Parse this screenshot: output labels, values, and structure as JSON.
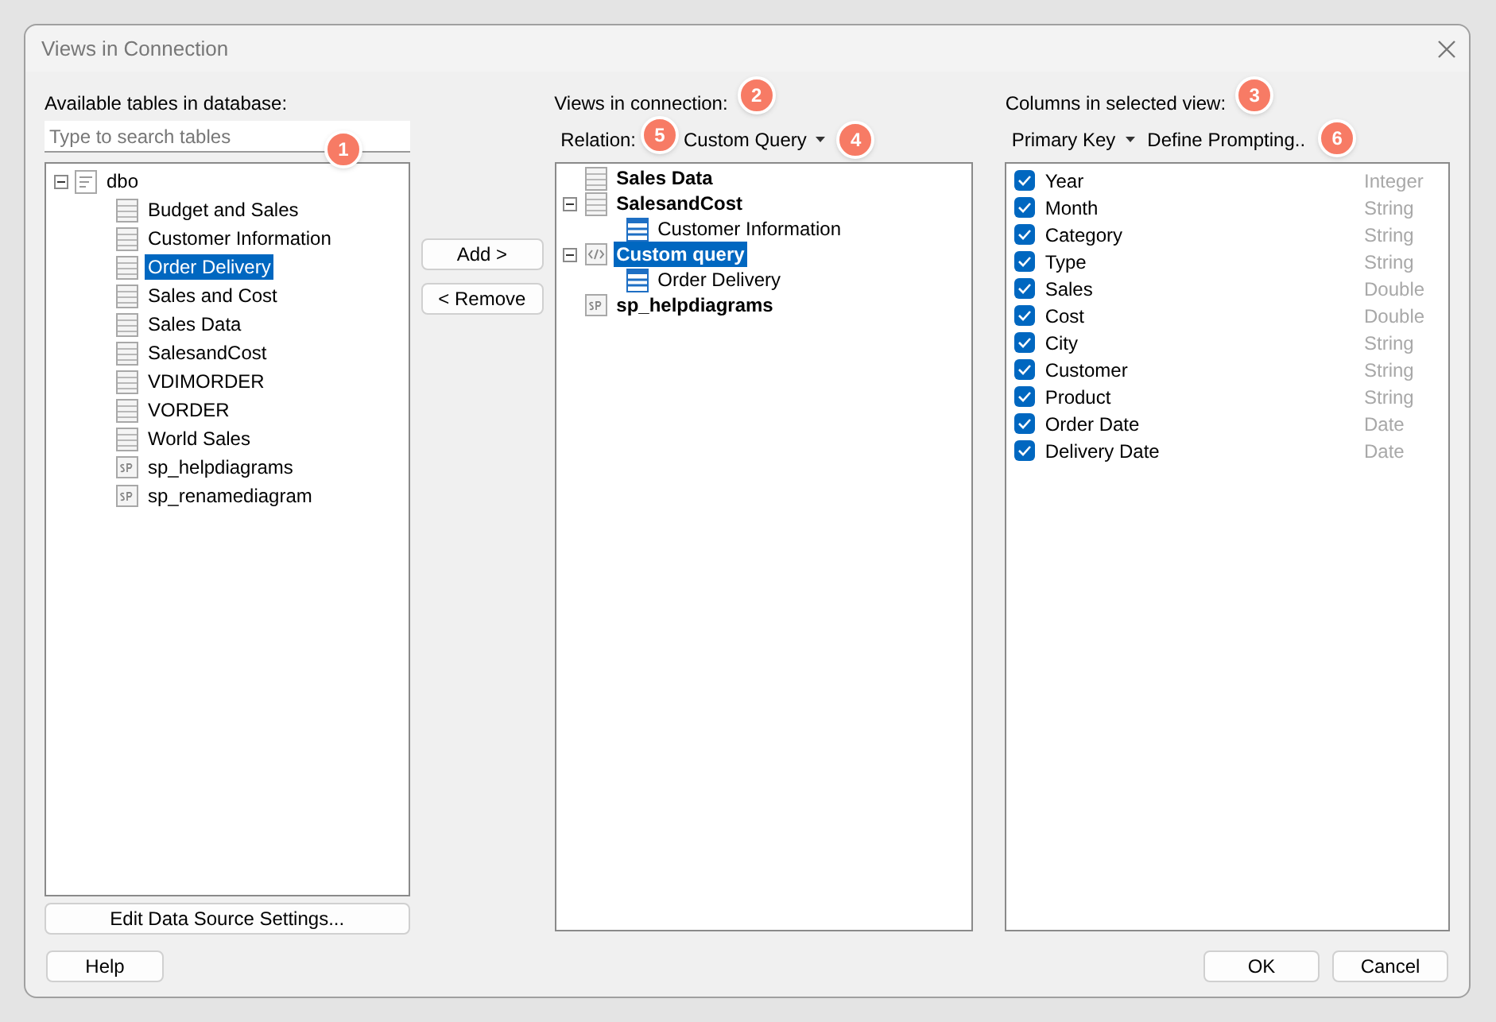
{
  "window": {
    "title": "Views in Connection"
  },
  "available": {
    "label": "Available tables in database:",
    "search": {
      "placeholder": "Type to search tables",
      "callout": "1"
    },
    "tree": [
      {
        "label": "dbo",
        "kind": "schema",
        "expanded": true,
        "selected": false,
        "children": [
          {
            "label": "Budget and Sales",
            "kind": "table",
            "selected": false
          },
          {
            "label": "Customer Information",
            "kind": "table",
            "selected": false
          },
          {
            "label": "Order Delivery",
            "kind": "table",
            "selected": true
          },
          {
            "label": "Sales and Cost",
            "kind": "table",
            "selected": false
          },
          {
            "label": "Sales Data",
            "kind": "table",
            "selected": false
          },
          {
            "label": "SalesandCost",
            "kind": "table",
            "selected": false
          },
          {
            "label": "VDIMORDER",
            "kind": "table",
            "selected": false
          },
          {
            "label": "VORDER",
            "kind": "table",
            "selected": false
          },
          {
            "label": "World Sales",
            "kind": "table",
            "selected": false
          },
          {
            "label": "sp_helpdiagrams",
            "kind": "sp",
            "selected": false
          },
          {
            "label": "sp_renamediagram",
            "kind": "sp",
            "selected": false
          }
        ]
      }
    ],
    "button": "Edit Data Source Settings..."
  },
  "transfer": [
    "Add >",
    "< Remove"
  ],
  "views": {
    "label": "Views in connection:",
    "callout": "2",
    "relation_label": "Relation:",
    "relation_callout": "5",
    "relation_value": "Custom Query",
    "dropdown_callout": "4",
    "tree": [
      {
        "label": "Sales Data",
        "kind": "table",
        "selected": false
      },
      {
        "label": "SalesandCost",
        "kind": "table",
        "expanded": true,
        "selected": false,
        "children": [
          {
            "label": "Customer Information",
            "kind": "view",
            "selected": false
          }
        ]
      },
      {
        "label": "Custom query",
        "kind": "query",
        "expanded": true,
        "selected": true,
        "children": [
          {
            "label": "Order Delivery",
            "kind": "view",
            "selected": false
          }
        ]
      },
      {
        "label": "sp_helpdiagrams",
        "kind": "sp",
        "selected": false
      }
    ]
  },
  "columns": {
    "label": "Columns in selected view:",
    "callout": "3",
    "primary_key": "Primary Key",
    "define": "Define Prompting..",
    "define_callout": "6",
    "rows": [
      {
        "name": "Year",
        "type": "Integer",
        "checked": true
      },
      {
        "name": "Month",
        "type": "String",
        "checked": true
      },
      {
        "name": "Category",
        "type": "String",
        "checked": true
      },
      {
        "name": "Type",
        "type": "String",
        "checked": true
      },
      {
        "name": "Sales",
        "type": "Double",
        "checked": true
      },
      {
        "name": "Cost",
        "type": "Double",
        "checked": true
      },
      {
        "name": "City",
        "type": "String",
        "checked": true
      },
      {
        "name": "Customer",
        "type": "String",
        "checked": true
      },
      {
        "name": "Product",
        "type": "String",
        "checked": true
      },
      {
        "name": "Order Date",
        "type": "Date",
        "checked": true
      },
      {
        "name": "Delivery Date",
        "type": "Date",
        "checked": true
      }
    ]
  },
  "buttons": {
    "help": "Help",
    "ok": "OK",
    "cancel": "Cancel"
  }
}
